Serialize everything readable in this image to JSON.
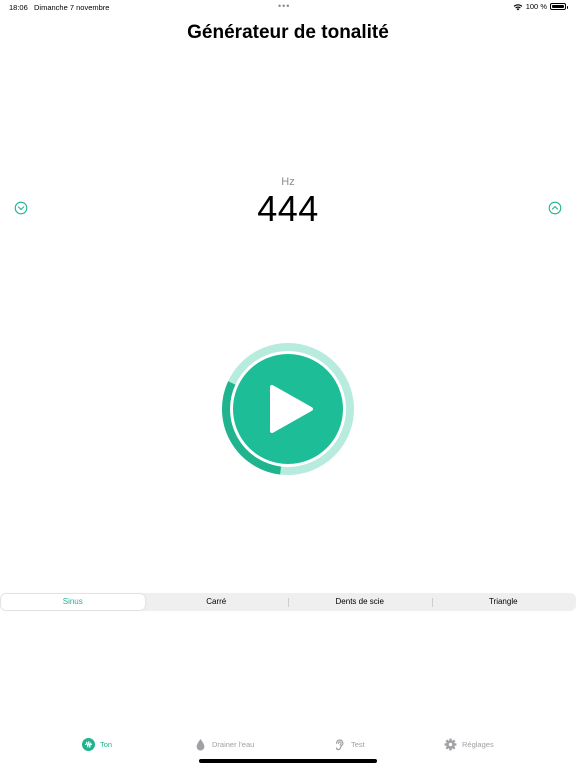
{
  "status": {
    "time": "18:06",
    "date": "Dimanche 7 novembre",
    "multitask_dots": "•••",
    "battery_text": "100 %",
    "battery_level_percent": 100
  },
  "header": {
    "title": "Générateur de tonalité"
  },
  "frequency": {
    "unit": "Hz",
    "value": "444"
  },
  "controls": {
    "decrease_icon": "chevron-down-circle-icon",
    "increase_icon": "chevron-up-circle-icon",
    "play_icon": "play-icon",
    "progress_fraction": 0.3
  },
  "waveforms": {
    "selected": "Sinus",
    "options": [
      "Sinus",
      "Carré",
      "Dents de scie",
      "Triangle"
    ]
  },
  "tabs": [
    {
      "label": "Ton",
      "icon": "waveform-icon",
      "active": true
    },
    {
      "label": "Drainer l'eau",
      "icon": "drop-icon",
      "active": false
    },
    {
      "label": "Test",
      "icon": "ear-icon",
      "active": false
    },
    {
      "label": "Réglages",
      "icon": "gear-icon",
      "active": false
    }
  ],
  "colors": {
    "accent": "#20b48e",
    "accent_light": "#b7ebdd",
    "play_fill": "#1dbd98"
  }
}
